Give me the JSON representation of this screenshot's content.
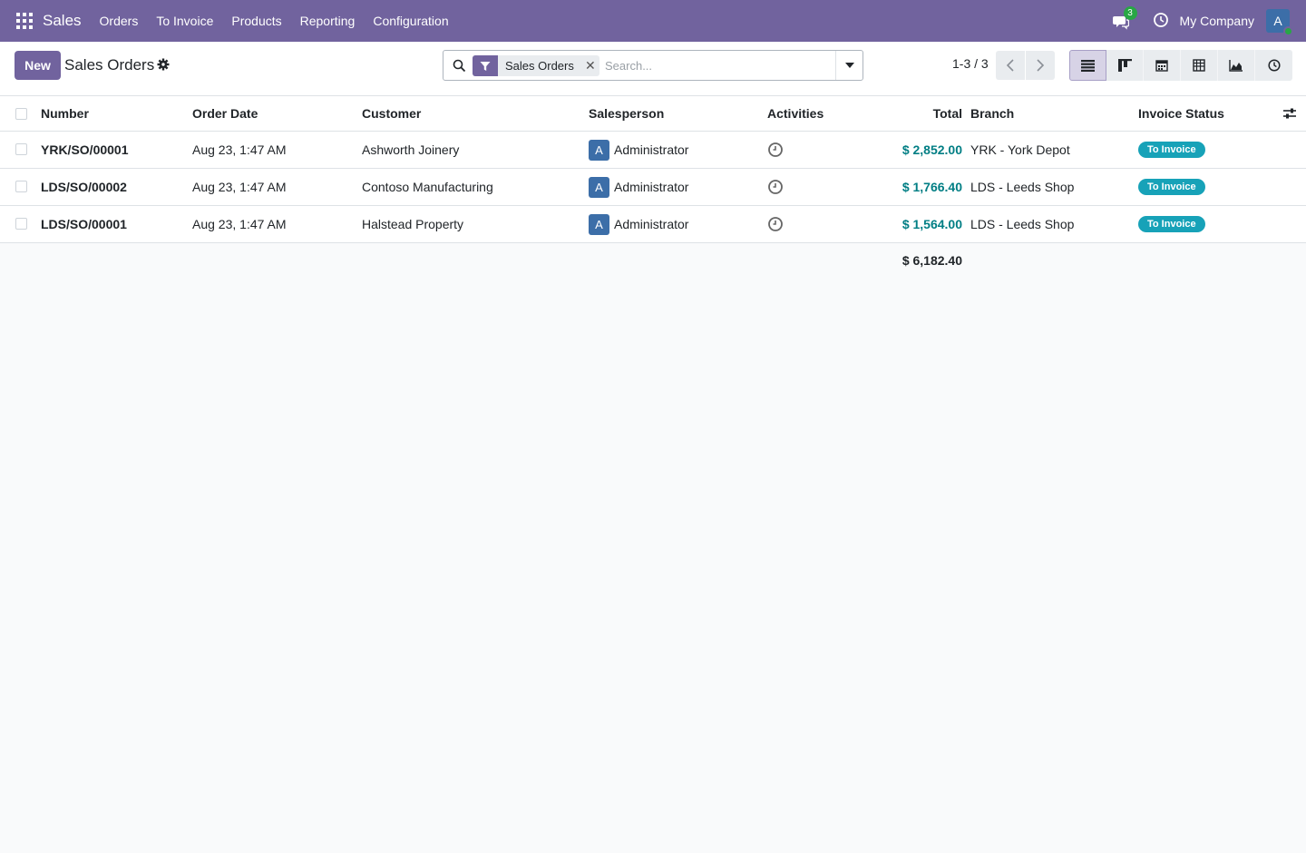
{
  "navbar": {
    "brand": "Sales",
    "menu": [
      "Orders",
      "To Invoice",
      "Products",
      "Reporting",
      "Configuration"
    ],
    "chat_count": "3",
    "company": "My Company",
    "user_initial": "A",
    "icons": {
      "apps": "apps-grid-icon",
      "chat": "chat-icon",
      "activity": "clock-icon"
    }
  },
  "control": {
    "new_label": "New",
    "title": "Sales Orders",
    "search": {
      "facet_label": "Sales Orders",
      "placeholder": "Search..."
    },
    "pager": "1-3 / 3",
    "views": [
      "list",
      "kanban",
      "calendar",
      "pivot",
      "graph",
      "activity"
    ]
  },
  "colors": {
    "navbar": "#71639e",
    "accent": "#71639e",
    "total_link": "#017e84",
    "badge": "#17a2b8",
    "avatar": "#3c6ea8"
  },
  "table": {
    "headers": {
      "number": "Number",
      "order_date": "Order Date",
      "customer": "Customer",
      "salesperson": "Salesperson",
      "activities": "Activities",
      "total": "Total",
      "branch": "Branch",
      "invoice_status": "Invoice Status"
    },
    "rows": [
      {
        "number": "YRK/SO/00001",
        "order_date": "Aug 23, 1:47 AM",
        "customer": "Ashworth Joinery",
        "salesperson_initial": "A",
        "salesperson": "Administrator",
        "total": "$ 2,852.00",
        "branch": "YRK - York Depot",
        "invoice_status": "To Invoice"
      },
      {
        "number": "LDS/SO/00002",
        "order_date": "Aug 23, 1:47 AM",
        "customer": "Contoso Manufacturing",
        "salesperson_initial": "A",
        "salesperson": "Administrator",
        "total": "$ 1,766.40",
        "branch": "LDS - Leeds Shop",
        "invoice_status": "To Invoice"
      },
      {
        "number": "LDS/SO/00001",
        "order_date": "Aug 23, 1:47 AM",
        "customer": "Halstead Property",
        "salesperson_initial": "A",
        "salesperson": "Administrator",
        "total": "$ 1,564.00",
        "branch": "LDS - Leeds Shop",
        "invoice_status": "To Invoice"
      }
    ],
    "grand_total": "$ 6,182.40"
  }
}
